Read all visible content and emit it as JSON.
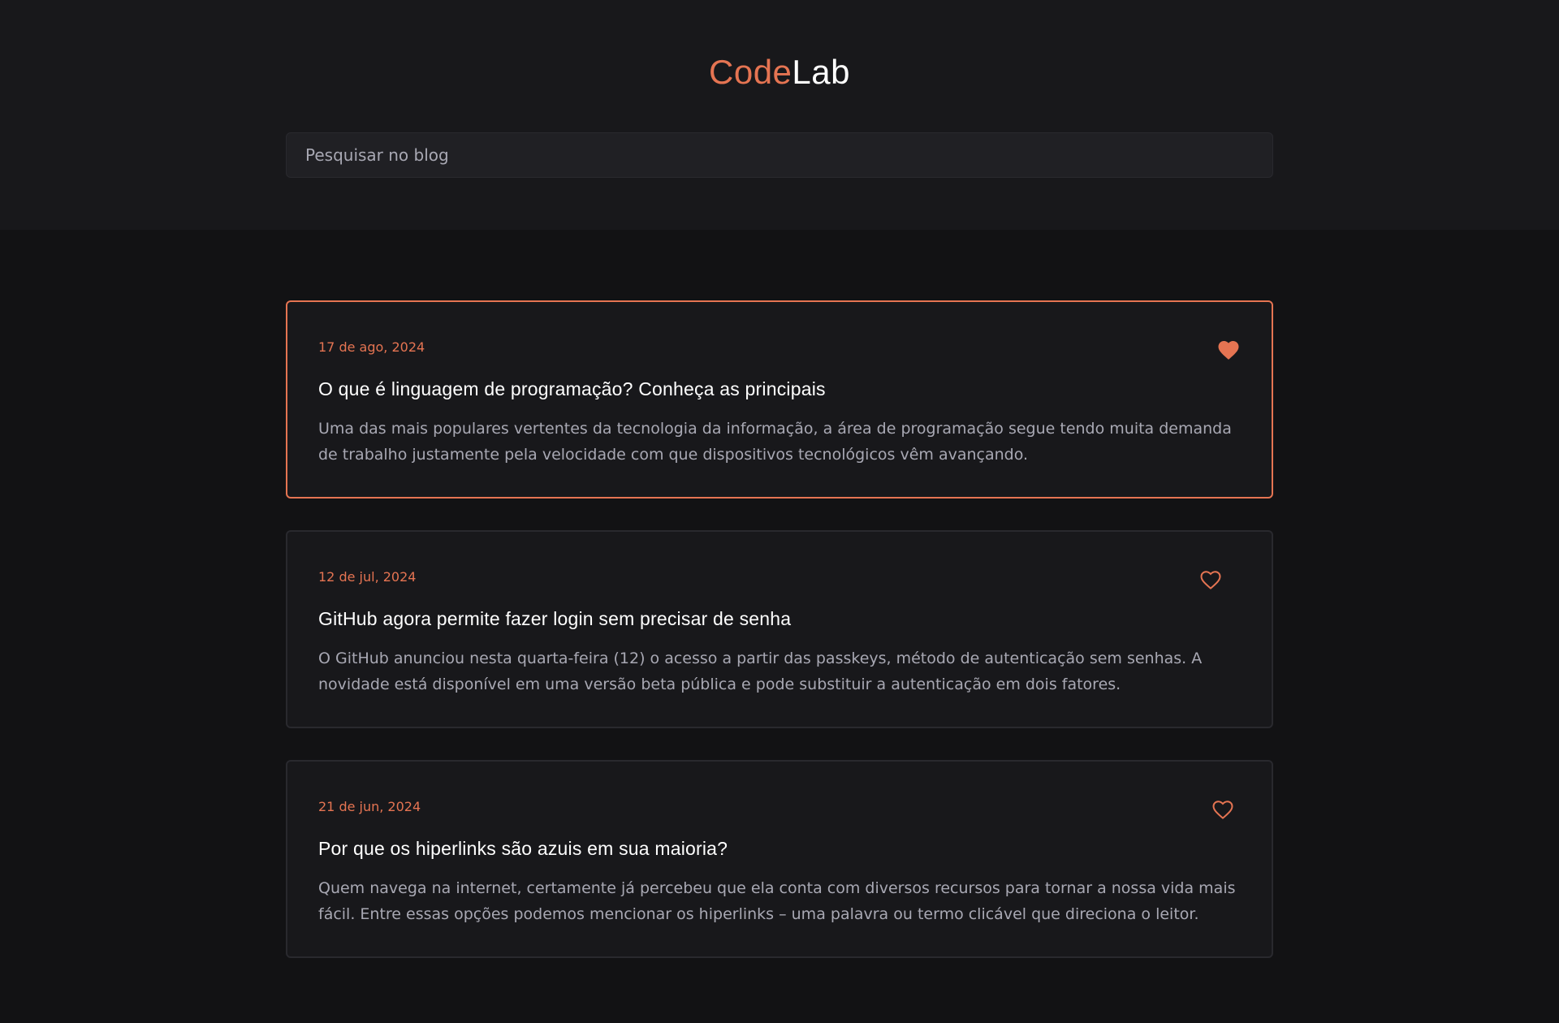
{
  "brand": {
    "accent_part": "Code",
    "rest_part": "Lab",
    "accent_color": "#e57452"
  },
  "search": {
    "placeholder": "Pesquisar no blog",
    "value": ""
  },
  "posts": [
    {
      "date": "17 de ago, 2024",
      "title": "O que é linguagem de programação? Conheça as principais",
      "excerpt": "Uma das mais populares vertentes da tecnologia da informação, a área de programação segue tendo muita demanda de trabalho justamente pela velocidade com que dispositivos tecnológicos vêm avançando.",
      "favorited": true,
      "icon": "heart-filled-icon"
    },
    {
      "date": "12 de jul, 2024",
      "title": "GitHub agora permite fazer login sem precisar de senha",
      "excerpt": "O GitHub anunciou nesta quarta-feira (12) o acesso a partir das passkeys, método de autenticação sem senhas. A novidade está disponível em uma versão beta pública e pode substituir a autenticação em dois fatores.",
      "favorited": false,
      "icon": "heart-outline-icon"
    },
    {
      "date": "21 de jun, 2024",
      "title": "Por que os hiperlinks são azuis em sua maioria?",
      "excerpt": "Quem navega na internet, certamente já percebeu que ela conta com diversos recursos para tornar a nossa vida mais fácil. Entre essas opções podemos mencionar os hiperlinks – uma palavra ou termo clicável que direciona o leitor.",
      "favorited": false,
      "icon": "heart-outline-icon"
    }
  ]
}
